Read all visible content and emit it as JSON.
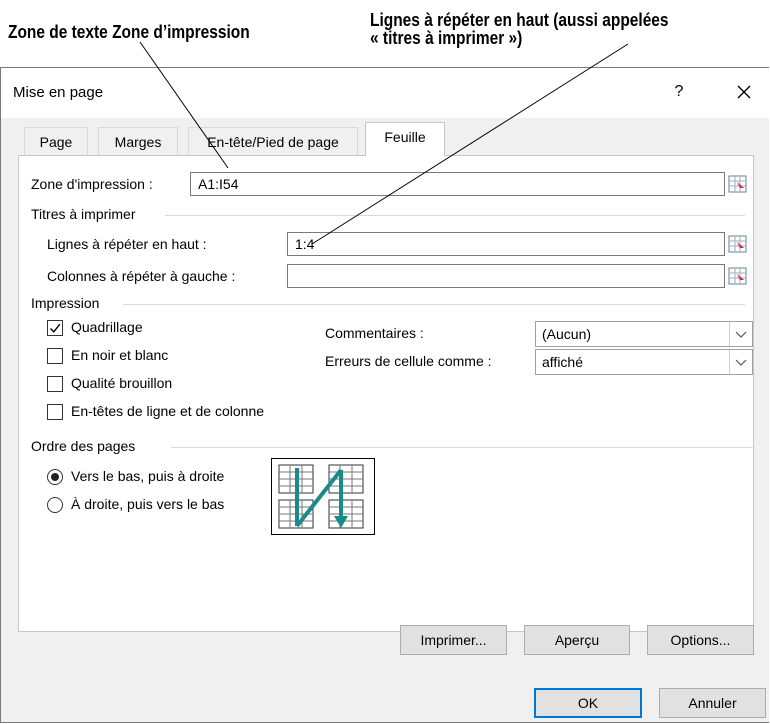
{
  "callouts": {
    "print_area": "Zone de texte Zone d’impression",
    "rows_repeat_line1": "Lignes à répéter en haut (aussi appelées",
    "rows_repeat_line2": "« titres à imprimer »)"
  },
  "dialog": {
    "title": "Mise en page",
    "help": "?",
    "close": "✕"
  },
  "tabs": [
    {
      "label": "Page"
    },
    {
      "label": "Marges"
    },
    {
      "label": "En-tête/Pied de page"
    },
    {
      "label": "Feuille",
      "active": true
    }
  ],
  "sheet": {
    "print_area": {
      "label": "Zone d'impression :",
      "value": "A1:I54"
    },
    "print_titles": {
      "heading": "Titres à imprimer"
    },
    "rows_repeat": {
      "label": "Lignes à répéter en haut :",
      "value": "1:4"
    },
    "cols_repeat": {
      "label": "Colonnes à répéter à gauche :",
      "value": ""
    },
    "print": {
      "heading": "Impression",
      "gridlines": {
        "label": "Quadrillage",
        "checked": true
      },
      "bw": {
        "label": "En noir et blanc",
        "checked": false
      },
      "draft": {
        "label": "Qualité brouillon",
        "checked": false
      },
      "headings": {
        "label": "En-têtes de ligne et de colonne",
        "checked": false
      },
      "comments": {
        "label": "Commentaires :",
        "value": "(Aucun)"
      },
      "errors": {
        "label": "Erreurs de cellule comme :",
        "value": "affiché"
      }
    },
    "page_order": {
      "heading": "Ordre des pages",
      "down_then_over": {
        "label": "Vers le bas, puis à droite",
        "selected": true
      },
      "over_then_down": {
        "label": "À droite, puis vers le bas",
        "selected": false
      }
    }
  },
  "buttons": {
    "print": "Imprimer...",
    "preview": "Aperçu",
    "options": "Options...",
    "ok": "OK",
    "cancel": "Annuler"
  },
  "colors": {
    "accent": "#0078d7",
    "arrow": "#1a8a8a",
    "collapse_red": "#d9262b"
  }
}
